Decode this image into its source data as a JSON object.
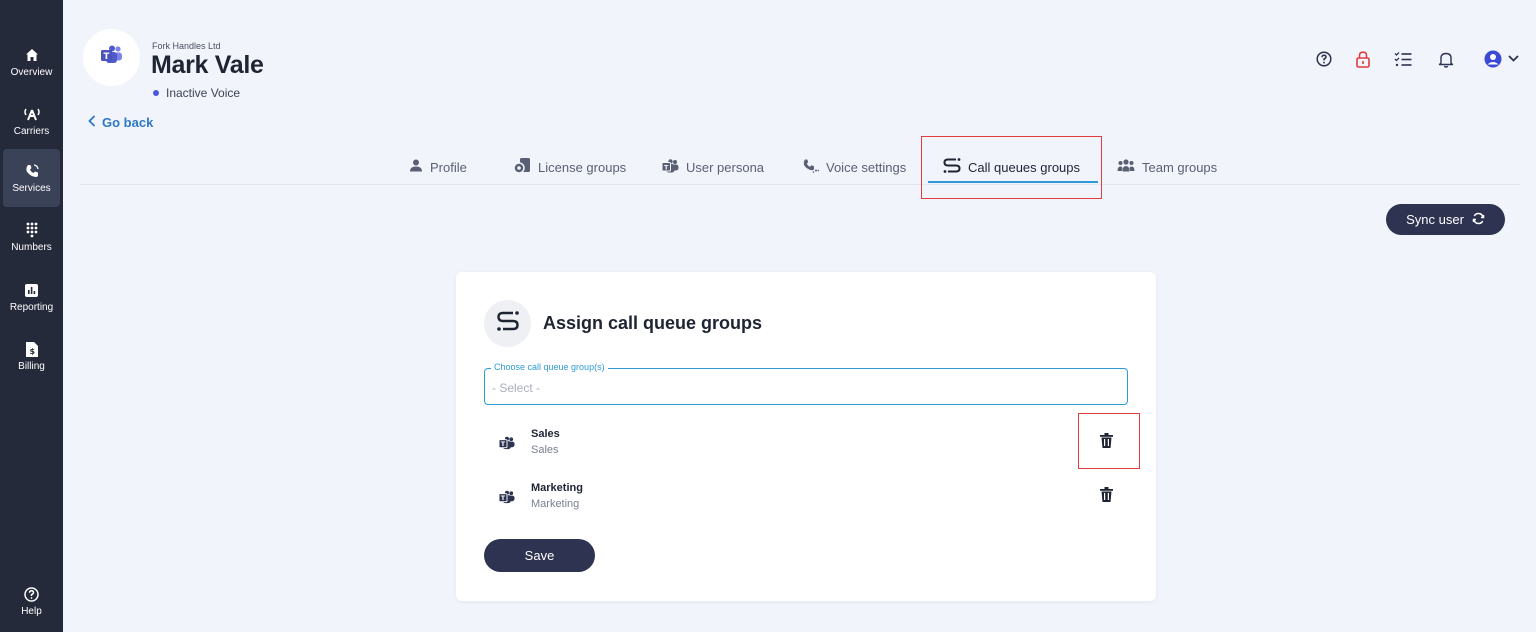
{
  "sidebar": {
    "items": [
      {
        "label": "Overview",
        "icon": "home-icon"
      },
      {
        "label": "Carriers",
        "icon": "antenna-icon"
      },
      {
        "label": "Services",
        "icon": "phone-icon"
      },
      {
        "label": "Numbers",
        "icon": "dialpad-icon"
      },
      {
        "label": "Reporting",
        "icon": "chart-icon"
      },
      {
        "label": "Billing",
        "icon": "invoice-icon"
      }
    ],
    "help": {
      "label": "Help",
      "icon": "help-icon"
    }
  },
  "header": {
    "company": "Fork Handles Ltd",
    "user_name": "Mark Vale",
    "status": "Inactive Voice",
    "go_back": "Go back"
  },
  "tabs": [
    {
      "label": "Profile",
      "icon": "person-icon"
    },
    {
      "label": "License groups",
      "icon": "license-icon"
    },
    {
      "label": "User persona",
      "icon": "teams-icon"
    },
    {
      "label": "Voice settings",
      "icon": "phone-settings-icon"
    },
    {
      "label": "Call queues groups",
      "icon": "call-queue-icon",
      "active": true
    },
    {
      "label": "Team groups",
      "icon": "team-icon"
    }
  ],
  "sync_button": "Sync user",
  "card": {
    "title": "Assign call queue groups",
    "select_legend": "Choose call queue group(s)",
    "select_placeholder": "- Select -",
    "groups": [
      {
        "name": "Sales",
        "description": "Sales"
      },
      {
        "name": "Marketing",
        "description": "Marketing"
      }
    ],
    "save_label": "Save"
  },
  "colors": {
    "sidebar": "#252a3b",
    "primary_button": "#2d3350",
    "accent": "#2e9bd6",
    "highlight": "#e23c3c",
    "status_dot": "#4a56e2"
  }
}
